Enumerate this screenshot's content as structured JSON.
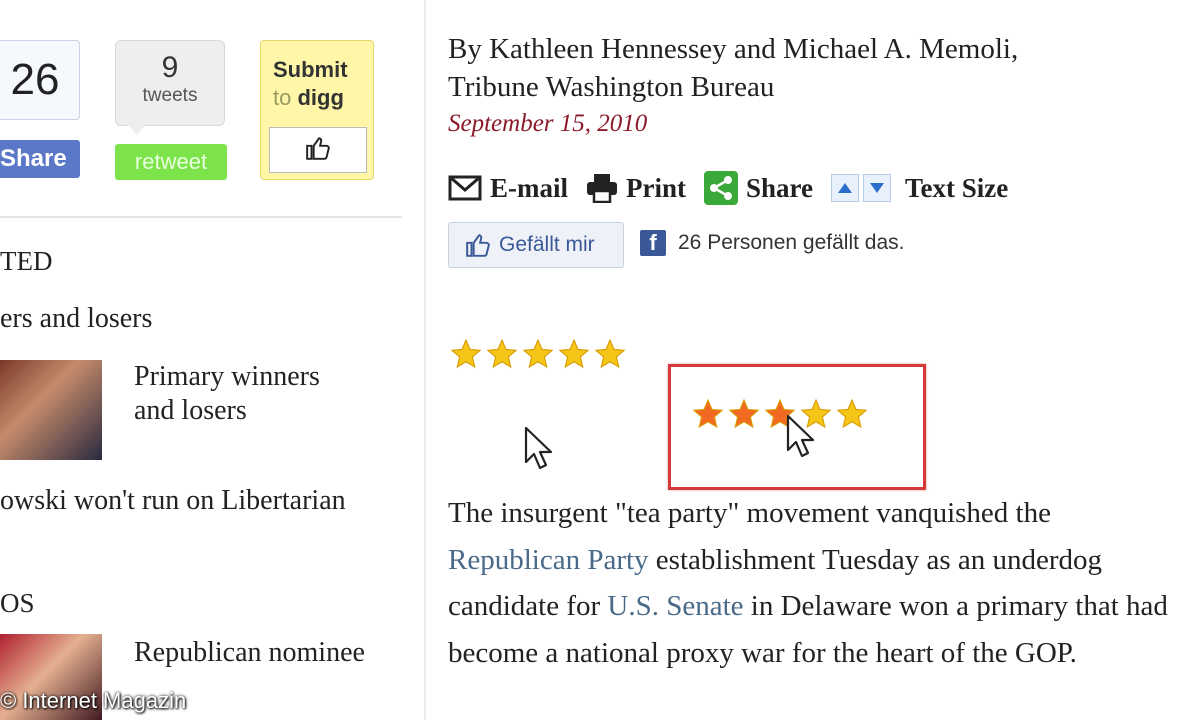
{
  "social": {
    "facebook_count": "26",
    "facebook_share_label": "Share",
    "tweet_count": "9",
    "tweet_label": "tweets",
    "retweet_label": "retweet",
    "digg_line1": "Submit",
    "digg_to": "to",
    "digg_word": "digg"
  },
  "sidebar": {
    "section1_header": "TED",
    "section1_title": "ers and losers",
    "story1_title_line1": "Primary winners",
    "story1_title_line2": "and losers",
    "story2_title": "owski won't run on Libertarian",
    "section2_header": "OS",
    "story3_title": "Republican nominee"
  },
  "watermark": "© Internet Magazin",
  "article": {
    "byline_line1": "By Kathleen Hennessey and Michael A. Memoli,",
    "byline_line2": "Tribune Washington Bureau",
    "date": "September 15, 2010",
    "tools": {
      "email_label": "E-mail",
      "print_label": "Print",
      "share_label": "Share",
      "text_size_label": "Text Size"
    },
    "like_button_label": "Gefällt mir",
    "like_count_text": "26 Personen gefällt das.",
    "rating_original_stars": 5,
    "rating_selected": 3,
    "rating_total": 5,
    "body": {
      "l1": "The insurgent \"tea party\" movement vanquished the",
      "l2_link": "Republican Party",
      "l2_rest": " establishment Tuesday as an underdog",
      "l3_pre": "candidate for ",
      "l3_link": "U.S. Senate",
      "l3_rest": " in Delaware won a primary that had",
      "l4": "become a national proxy war for the heart of the GOP."
    }
  },
  "colors": {
    "date_color": "#8b1a2b",
    "link_color": "#4a6a8a",
    "highlight_border": "#d43a3a",
    "star_gold": "#f5c518",
    "star_orange": "#f26a21"
  }
}
